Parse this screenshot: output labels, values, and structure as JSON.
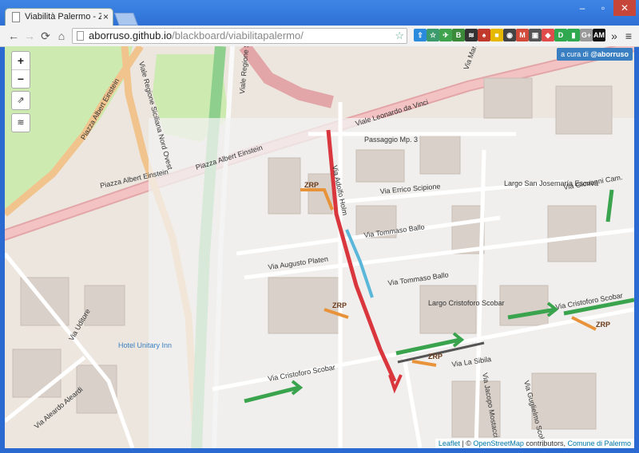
{
  "browser": {
    "tab_title": "Viabilità Palermo - ZONA",
    "tab_close": "×",
    "window_controls": {
      "minimize": "–",
      "maximize": "▫",
      "close": "✕"
    },
    "nav": {
      "back": "←",
      "forward": "→",
      "reload": "⟳",
      "home": "⌂"
    },
    "url_host": "aborruso.github.io",
    "url_path": "/blackboard/viabilitapalermo/",
    "star_icon": "☆",
    "menu_icon": "≡",
    "overflow": "»"
  },
  "extensions": [
    {
      "name": "extension-icon-1",
      "color": "#2a8adc",
      "glyph": "⇧"
    },
    {
      "name": "extension-icon-2",
      "color": "#3c9b6c",
      "glyph": "☆"
    },
    {
      "name": "extension-icon-3",
      "color": "#3fa34d",
      "glyph": "✈"
    },
    {
      "name": "extension-icon-4",
      "color": "#3a8a3a",
      "glyph": "B"
    },
    {
      "name": "extension-icon-5",
      "color": "#333333",
      "glyph": "≋"
    },
    {
      "name": "extension-icon-6",
      "color": "#c0392b",
      "glyph": "♠"
    },
    {
      "name": "extension-icon-7",
      "color": "#e6b800",
      "glyph": "■"
    },
    {
      "name": "extension-icon-8",
      "color": "#444444",
      "glyph": "◉"
    },
    {
      "name": "extension-icon-9",
      "color": "#d24a3a",
      "glyph": "M"
    },
    {
      "name": "extension-icon-10",
      "color": "#555555",
      "glyph": "▣"
    },
    {
      "name": "extension-icon-11",
      "color": "#e04b4b",
      "glyph": "◆"
    },
    {
      "name": "extension-icon-12",
      "color": "#2fa84f",
      "glyph": "D"
    },
    {
      "name": "extension-icon-13",
      "color": "#2fa84f",
      "glyph": "▮"
    },
    {
      "name": "extension-icon-14",
      "color": "#999999",
      "glyph": "G+"
    },
    {
      "name": "extension-icon-15",
      "color": "#111111",
      "glyph": "AM"
    }
  ],
  "map": {
    "zoom_in": "+",
    "zoom_out": "−",
    "share_icon": "⇗",
    "layers_icon": "≋",
    "credit_prefix": "a cura di ",
    "credit_handle": "@aborruso",
    "attribution_leaflet": "Leaflet",
    "attribution_sep": " | © ",
    "attribution_osm": "OpenStreetMap",
    "attribution_rest": " contributors, ",
    "attribution_comune": "Comune di Palermo",
    "labels": {
      "leonardo": "Viale Leonardo da Vinci",
      "albert1": "Piazza Albert Einstein",
      "albert2": "Piazza Albert Einstein",
      "albert3": "Piazza Albert Einstein",
      "sicilia": "Viale Regione Siciliana Nord Ovest",
      "mariano_right": "Via Mariano Migliaccio",
      "passaggio": "Passaggio Mp. 3",
      "scipione": "Via Errico Scipione",
      "ballo": "Via Tommaso Ballo",
      "platen": "Via Augusto Platen",
      "holm": "Via Adolfo Holm",
      "largo_san": "Largo San Josemaría Escrivá",
      "largo_cristoforo": "Largo Cristoforo Scobar",
      "cristoforo": "Via Cristoforo Scobar",
      "cristoforo_right": "Via Cristoforo Scobar",
      "uditore": "Via Uditore",
      "aleardi": "Via Aleardo Aleardi",
      "hotel": "Hotel Unitary Inn",
      "zrp": "ZRP",
      "giovanni": "Via Giovanni Cam.",
      "jacopo": "Via Jacopo Mostacci",
      "sibila": "Via La Sibila",
      "guglielmo": "Via Guglielmo Scobar"
    }
  }
}
